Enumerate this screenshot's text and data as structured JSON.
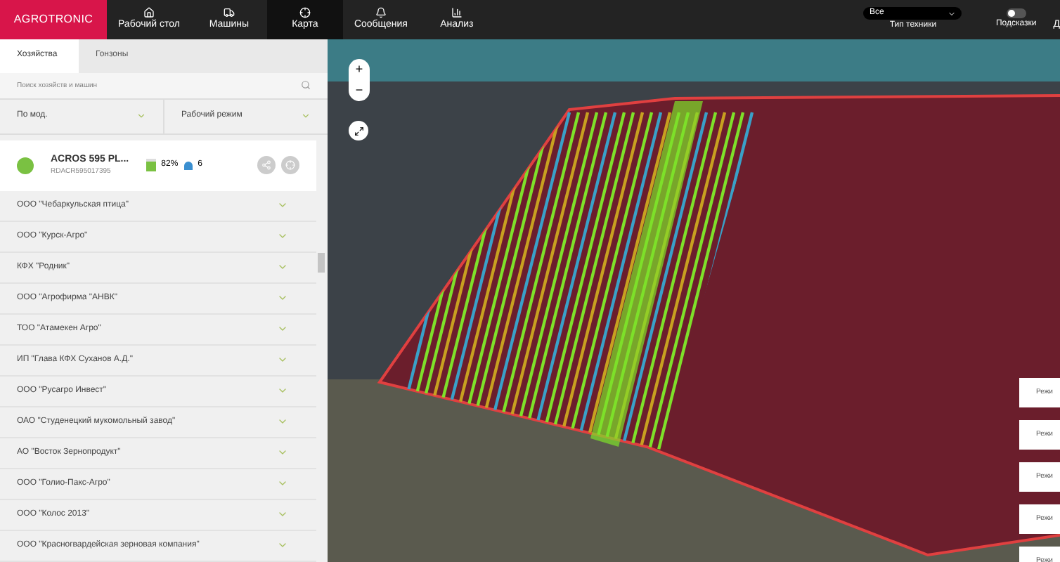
{
  "brand": "AGROTRONIC",
  "nav": [
    {
      "label": "Рабочий стол",
      "selected": false
    },
    {
      "label": "Машины",
      "selected": false
    },
    {
      "label": "Карта",
      "selected": true
    },
    {
      "label": "Сообщения",
      "selected": false
    },
    {
      "label": "Анализ",
      "selected": false
    }
  ],
  "machine_type": {
    "value": "Все",
    "label": "Тип техники"
  },
  "hints": {
    "label": "Подсказки",
    "on": false
  },
  "header_cut": "Д",
  "tabs": [
    {
      "label": "Хозяйства",
      "selected": true
    },
    {
      "label": "Гонзоны",
      "selected": false
    }
  ],
  "search": {
    "placeholder": "Поиск хозяйств и машин"
  },
  "filters": [
    "По мод.",
    "Рабочий режим"
  ],
  "machine": {
    "name": "ACROS 595 PL...",
    "serial": "RDACR595017395",
    "level": 0.82,
    "reading": "82%",
    "count": "6"
  },
  "farms": [
    {
      "name": "ООО \"Чебаркульская птица\"",
      "expanded": false
    },
    {
      "name": "ООО \"Курск-Агро\"",
      "expanded": false
    },
    {
      "name": "КФХ \"Родник\"",
      "expanded": false
    },
    {
      "name": "ООО \"Агрофирма \"АНВК\"",
      "expanded": false
    },
    {
      "name": "ТОО \"Атамекен Агро\"",
      "expanded": false
    },
    {
      "name": "ИП \"Глава КФХ Суханов А.Д.\"",
      "expanded": false
    },
    {
      "name": "ООО \"Русагро Инвест\"",
      "expanded": false
    },
    {
      "name": "ОАО \"Студенецкий мукомольный завод\"",
      "expanded": false
    },
    {
      "name": "АО \"Восток Зернопродукт\"",
      "expanded": false
    },
    {
      "name": "ООО \"Голио-Пакс-Агро\"",
      "expanded": false
    },
    {
      "name": "ООО \"Колос 2013\"",
      "expanded": false
    },
    {
      "name": "ООО \"Красногвардейская зерновая компания\"",
      "expanded": false
    }
  ],
  "map_controls": {
    "zoom_in": "+",
    "zoom_out": "−"
  },
  "mode_buttons": [
    "Режи",
    "Режи",
    "Режи",
    "Режи",
    "Режи"
  ]
}
